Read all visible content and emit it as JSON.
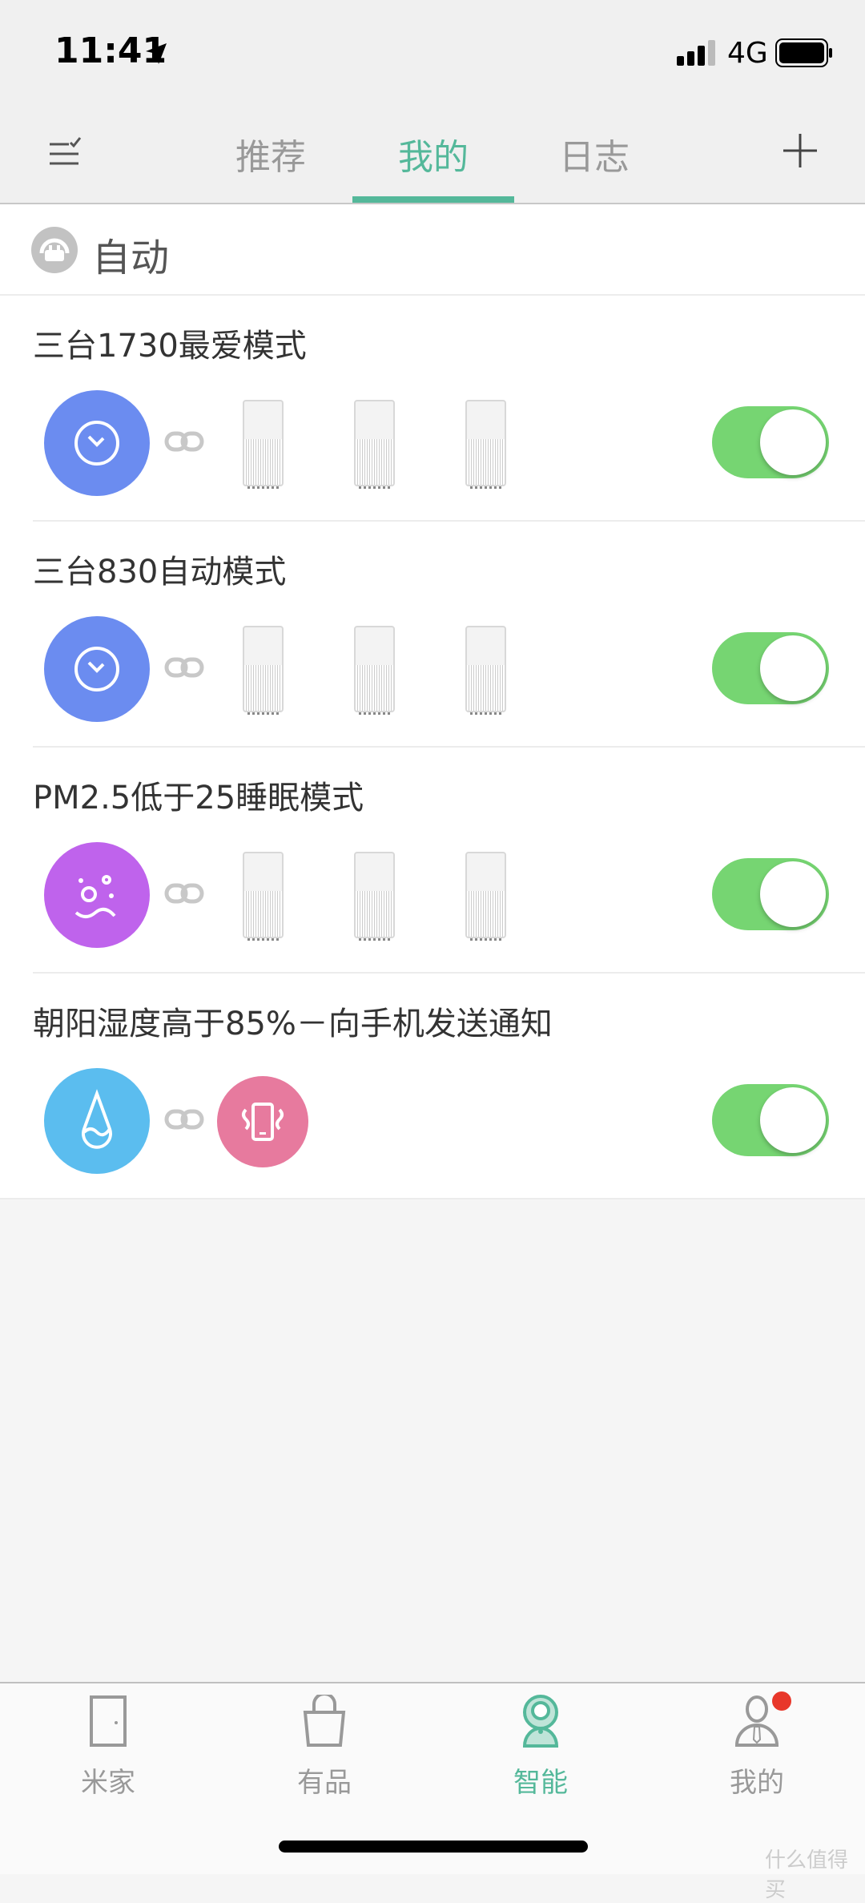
{
  "status_bar": {
    "time": "11:41",
    "network": "4G",
    "location_icon": "location-arrow-icon",
    "battery_level": 1.0
  },
  "nav": {
    "tabs": [
      {
        "label": "推荐"
      },
      {
        "label": "我的",
        "active": true
      },
      {
        "label": "日志"
      }
    ],
    "left_icon": "checklist-icon",
    "right_icon": "plus-icon",
    "accent": "#54b89a"
  },
  "section": {
    "title": "自动",
    "icon": "automation-icon"
  },
  "scenes": [
    {
      "title": "三台1730最爱模式",
      "trigger": "clock-icon",
      "trigger_color": "#6b8cf0",
      "actions": [
        "air-purifier",
        "air-purifier",
        "air-purifier"
      ],
      "enabled": true
    },
    {
      "title": "三台830自动模式",
      "trigger": "clock-icon",
      "trigger_color": "#6b8cf0",
      "actions": [
        "air-purifier",
        "air-purifier",
        "air-purifier"
      ],
      "enabled": true
    },
    {
      "title": "PM2.5低于25睡眠模式",
      "trigger": "pm25-icon",
      "trigger_color": "#bf63ec",
      "actions": [
        "air-purifier",
        "air-purifier",
        "air-purifier"
      ],
      "enabled": true
    },
    {
      "title": "朝阳湿度高于85%－向手机发送通知",
      "trigger": "humidity-drop-icon",
      "trigger_color": "#5bbdef",
      "actions": [
        "phone-notification"
      ],
      "action_color": "#e77a9e",
      "enabled": true
    }
  ],
  "tabbar": {
    "items": [
      {
        "label": "米家",
        "icon": "door-icon"
      },
      {
        "label": "有品",
        "icon": "bag-icon"
      },
      {
        "label": "智能",
        "icon": "camera-icon",
        "active": true
      },
      {
        "label": "我的",
        "icon": "profile-icon",
        "badge": true
      }
    ],
    "badge_color": "#e8372a"
  },
  "watermark": "什么值得买"
}
